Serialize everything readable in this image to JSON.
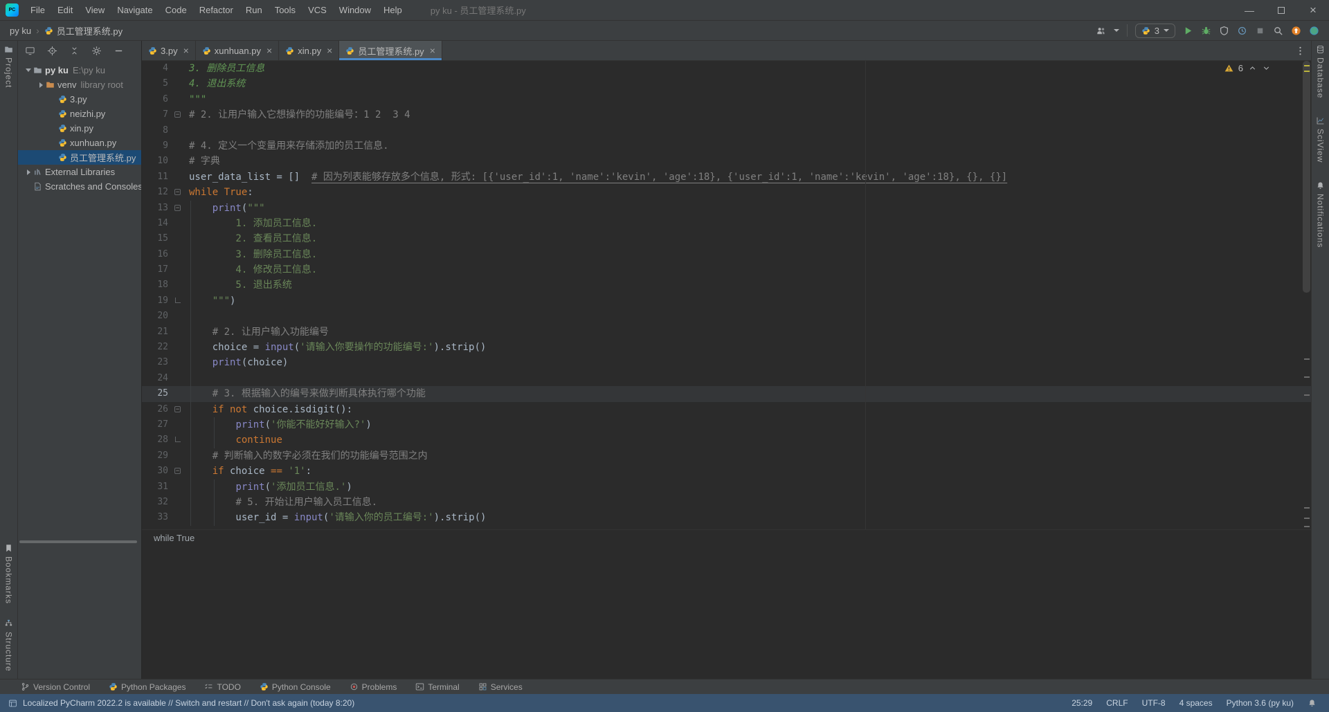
{
  "colors": {
    "accent_blue": "#4A88C7",
    "keyword_orange": "#CC7832",
    "string_green": "#6A8759",
    "comment_gray": "#808080",
    "warning_yellow": "#D8A735",
    "run_green": "#5FAD65",
    "update_orange": "#E08027",
    "selection_blue": "#1C4A74"
  },
  "title_bar": {
    "menus": [
      "File",
      "Edit",
      "View",
      "Navigate",
      "Code",
      "Refactor",
      "Run",
      "Tools",
      "VCS",
      "Window",
      "Help"
    ],
    "window_title": "py ku - 员工管理系统.py"
  },
  "nav_bar": {
    "breadcrumb_project": "py ku",
    "breadcrumb_file": "员工管理系统.py",
    "run_config": "3"
  },
  "stripes": {
    "left_top": [
      {
        "label": "Project",
        "icon": "project-icon"
      }
    ],
    "left_bottom": [
      {
        "label": "Bookmarks",
        "icon": "bookmark-icon"
      },
      {
        "label": "Structure",
        "icon": "structure-icon"
      }
    ],
    "right": [
      {
        "label": "Database",
        "icon": "database-icon"
      },
      {
        "label": "SciView",
        "icon": "sciview-icon"
      },
      {
        "label": "Notifications",
        "icon": "bell-icon"
      }
    ]
  },
  "project_panel": {
    "tree": [
      {
        "label": "py ku",
        "suffix": "E:\\py ku",
        "icon": "folder",
        "level": 0,
        "chevron": "down",
        "bold": true
      },
      {
        "label": "venv",
        "suffix": "library root",
        "icon": "folder-excluded",
        "level": 1,
        "chevron": "right"
      },
      {
        "label": "3.py",
        "icon": "python-file",
        "level": 2
      },
      {
        "label": "neizhi.py",
        "icon": "python-file",
        "level": 2
      },
      {
        "label": "xin.py",
        "icon": "python-file",
        "level": 2
      },
      {
        "label": "xunhuan.py",
        "icon": "python-file",
        "level": 2
      },
      {
        "label": "员工管理系统.py",
        "icon": "python-file",
        "level": 2,
        "selected": true
      },
      {
        "label": "External Libraries",
        "icon": "libraries",
        "level": 0,
        "chevron": "right"
      },
      {
        "label": "Scratches and Consoles",
        "icon": "scratches",
        "level": 0
      }
    ]
  },
  "tabs": [
    {
      "label": "3.py",
      "active": false
    },
    {
      "label": "xunhuan.py",
      "active": false
    },
    {
      "label": "xin.py",
      "active": false
    },
    {
      "label": "员工管理系统.py",
      "active": true
    }
  ],
  "editor": {
    "warning_count": "6",
    "breadcrumb": "while True",
    "current_line": 25,
    "lines": [
      {
        "n": 4,
        "tok": [
          [
            "ds",
            "3. 删除员工信息"
          ]
        ]
      },
      {
        "n": 5,
        "tok": [
          [
            "ds",
            "4. 退出系统"
          ]
        ]
      },
      {
        "n": 6,
        "tok": [
          [
            "ds",
            "\"\"\""
          ]
        ]
      },
      {
        "n": 7,
        "fold": "m",
        "tok": [
          [
            "c",
            "# 2. 让用户输入它想操作的功能编号：1 2  3 4"
          ]
        ]
      },
      {
        "n": 8,
        "tok": []
      },
      {
        "n": 9,
        "tok": [
          [
            "c",
            "# 4. 定义一个变量用来存储添加的员工信息."
          ]
        ]
      },
      {
        "n": 10,
        "tok": [
          [
            "c",
            "# 字典"
          ]
        ]
      },
      {
        "n": 11,
        "tok": [
          [
            "p",
            "user_data_list = []  "
          ],
          [
            "cu",
            "# 因为列表能够存放多个信息, 形式: [{'user_id':1, 'name':'kevin', 'age':18}, {'user_id':1, 'name':'kevin', 'age':18}, {}, {}]"
          ]
        ]
      },
      {
        "n": 12,
        "fold": "m",
        "tok": [
          [
            "k",
            "while True"
          ],
          [
            "p",
            ":"
          ]
        ]
      },
      {
        "n": 13,
        "fold": "m",
        "g": [
          0
        ],
        "tok": [
          [
            "p",
            "    "
          ],
          [
            "b",
            "print"
          ],
          [
            "p",
            "("
          ],
          [
            "s",
            "\"\"\""
          ]
        ]
      },
      {
        "n": 14,
        "g": [
          0
        ],
        "tok": [
          [
            "s",
            "        1. 添加员工信息."
          ]
        ]
      },
      {
        "n": 15,
        "g": [
          0
        ],
        "tok": [
          [
            "s",
            "        2. 查看员工信息."
          ]
        ]
      },
      {
        "n": 16,
        "g": [
          0
        ],
        "tok": [
          [
            "s",
            "        3. 删除员工信息."
          ]
        ]
      },
      {
        "n": 17,
        "g": [
          0
        ],
        "tok": [
          [
            "s",
            "        4. 修改员工信息."
          ]
        ]
      },
      {
        "n": 18,
        "g": [
          0
        ],
        "tok": [
          [
            "s",
            "        5. 退出系统"
          ]
        ]
      },
      {
        "n": 19,
        "fold": "e",
        "g": [
          0
        ],
        "tok": [
          [
            "s",
            "    \"\"\""
          ],
          [
            "p",
            ")"
          ]
        ]
      },
      {
        "n": 20,
        "g": [
          0
        ],
        "tok": []
      },
      {
        "n": 21,
        "g": [
          0
        ],
        "tok": [
          [
            "p",
            "    "
          ],
          [
            "c",
            "# 2. 让用户输入功能编号"
          ]
        ]
      },
      {
        "n": 22,
        "g": [
          0
        ],
        "tok": [
          [
            "p",
            "    choice = "
          ],
          [
            "b",
            "input"
          ],
          [
            "p",
            "("
          ],
          [
            "s",
            "'请输入你要操作的功能编号:'"
          ],
          [
            "p",
            ").strip()"
          ]
        ]
      },
      {
        "n": 23,
        "g": [
          0
        ],
        "tok": [
          [
            "p",
            "    "
          ],
          [
            "b",
            "print"
          ],
          [
            "p",
            "(choice)"
          ]
        ]
      },
      {
        "n": 24,
        "g": [
          0
        ],
        "tok": []
      },
      {
        "n": 25,
        "g": [
          0
        ],
        "tok": [
          [
            "p",
            "    "
          ],
          [
            "c",
            "# 3. 根据输入的编号来做判断具体执行哪个功能"
          ]
        ]
      },
      {
        "n": 26,
        "fold": "m",
        "g": [
          0
        ],
        "tok": [
          [
            "p",
            "    "
          ],
          [
            "k",
            "if not"
          ],
          [
            "p",
            " choice.isdigit():"
          ]
        ]
      },
      {
        "n": 27,
        "g": [
          0,
          1
        ],
        "tok": [
          [
            "p",
            "        "
          ],
          [
            "b",
            "print"
          ],
          [
            "p",
            "("
          ],
          [
            "s",
            "'你能不能好好输入?'"
          ],
          [
            "p",
            ")"
          ]
        ]
      },
      {
        "n": 28,
        "fold": "e",
        "g": [
          0,
          1
        ],
        "tok": [
          [
            "p",
            "        "
          ],
          [
            "k",
            "continue"
          ]
        ]
      },
      {
        "n": 29,
        "g": [
          0
        ],
        "tok": [
          [
            "p",
            "    "
          ],
          [
            "c",
            "# 判断输入的数字必须在我们的功能编号范围之内"
          ]
        ]
      },
      {
        "n": 30,
        "fold": "m",
        "g": [
          0
        ],
        "tok": [
          [
            "p",
            "    "
          ],
          [
            "k",
            "if"
          ],
          [
            "p",
            " choice "
          ],
          [
            "k",
            "=="
          ],
          [
            "p",
            " "
          ],
          [
            "s",
            "'1'"
          ],
          [
            "p",
            ":"
          ]
        ]
      },
      {
        "n": 31,
        "g": [
          0,
          1
        ],
        "tok": [
          [
            "p",
            "        "
          ],
          [
            "b",
            "print"
          ],
          [
            "p",
            "("
          ],
          [
            "s",
            "'添加员工信息.'"
          ],
          [
            "p",
            ")"
          ]
        ]
      },
      {
        "n": 32,
        "g": [
          0,
          1
        ],
        "tok": [
          [
            "p",
            "        "
          ],
          [
            "c",
            "# 5. 开始让用户输入员工信息."
          ]
        ]
      },
      {
        "n": 33,
        "g": [
          0,
          1
        ],
        "tok": [
          [
            "p",
            "        user_id = "
          ],
          [
            "b",
            "input"
          ],
          [
            "p",
            "("
          ],
          [
            "s",
            "'请输入你的员工编号:'"
          ],
          [
            "p",
            ").strip()"
          ]
        ]
      }
    ]
  },
  "tool_window_bar": [
    {
      "label": "Version Control",
      "icon": "version-control-icon",
      "iconKey": "branch"
    },
    {
      "label": "Python Packages",
      "icon": "python-packages-icon",
      "iconKey": "py"
    },
    {
      "label": "TODO",
      "icon": "todo-icon",
      "iconKey": "todo"
    },
    {
      "label": "Python Console",
      "icon": "python-console-icon",
      "iconKey": "py"
    },
    {
      "label": "Problems",
      "icon": "problems-icon",
      "iconKey": "problems"
    },
    {
      "label": "Terminal",
      "icon": "terminal-icon",
      "iconKey": "terminal"
    },
    {
      "label": "Services",
      "icon": "services-icon",
      "iconKey": "services"
    }
  ],
  "status_bar": {
    "message": "Localized PyCharm 2022.2 is available // Switch and restart // Don't ask again (today 8:20)",
    "caret": "25:29",
    "line_ending": "CRLF",
    "encoding": "UTF-8",
    "indent": "4 spaces",
    "interpreter": "Python 3.6 (py ku)"
  }
}
